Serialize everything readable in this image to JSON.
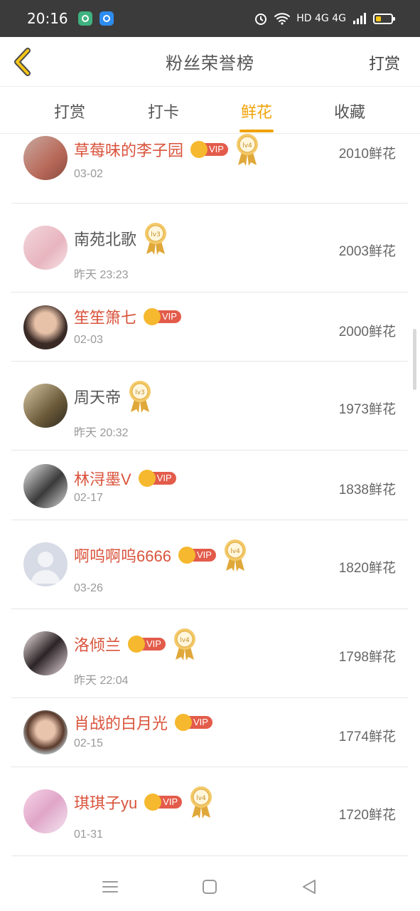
{
  "status_bar": {
    "time": "20:16",
    "network": "HD 4G 4G"
  },
  "header": {
    "title": "粉丝荣誉榜",
    "action": "打赏"
  },
  "tabs": [
    {
      "label": "打赏",
      "active": false
    },
    {
      "label": "打卡",
      "active": false
    },
    {
      "label": "鲜花",
      "active": true
    },
    {
      "label": "收藏",
      "active": false
    }
  ],
  "badges": {
    "vip_text": "VIP"
  },
  "colors": {
    "accent": "#f0a30a",
    "vip_name": "#d9533b",
    "vip_pill": "#e35b4a",
    "crown": "#f5b82e",
    "medal": "#e0a83a"
  },
  "users": [
    {
      "name": "草莓味的李子园",
      "vip": true,
      "level": "lv4",
      "date": "03-02",
      "count": "2010鲜花"
    },
    {
      "name": "南苑北歌",
      "vip": false,
      "level": "lv3",
      "date": "昨天 23:23",
      "count": "2003鲜花"
    },
    {
      "name": "笙笙箫七",
      "vip": true,
      "level": "",
      "date": "02-03",
      "count": "2000鲜花"
    },
    {
      "name": "周天帝",
      "vip": false,
      "level": "lv3",
      "date": "昨天 20:32",
      "count": "1973鲜花"
    },
    {
      "name": "林浔墨V",
      "vip": true,
      "level": "",
      "date": "02-17",
      "count": "1838鲜花"
    },
    {
      "name": "啊呜啊呜6666",
      "vip": true,
      "level": "lv4",
      "date": "03-26",
      "count": "1820鲜花"
    },
    {
      "name": "洛倾兰",
      "vip": true,
      "level": "lv4",
      "date": "昨天 22:04",
      "count": "1798鲜花"
    },
    {
      "name": "肖战的白月光",
      "vip": true,
      "level": "",
      "date": "02-15",
      "count": "1774鲜花"
    },
    {
      "name": "琪琪子yu",
      "vip": true,
      "level": "lv4",
      "date": "01-31",
      "count": "1720鲜花"
    }
  ]
}
